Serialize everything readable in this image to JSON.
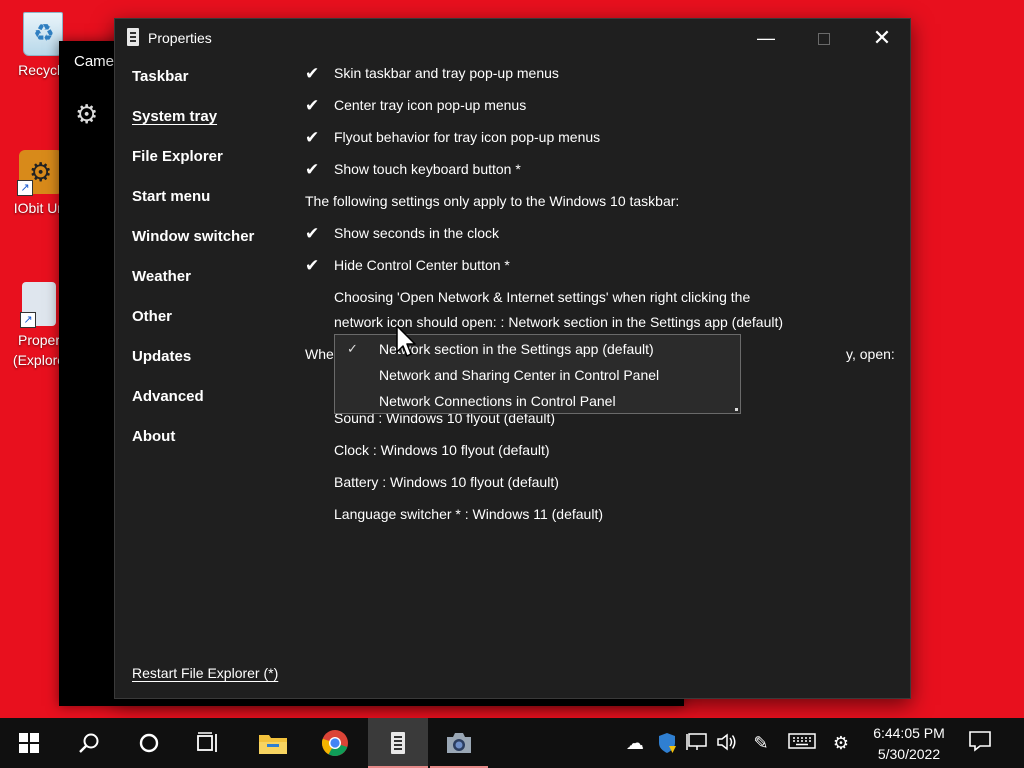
{
  "desktop": {
    "icons": [
      {
        "label": "Recycle"
      },
      {
        "label": "IObit Unl"
      },
      {
        "label": "Proper",
        "label2": "(Explore"
      }
    ]
  },
  "camera_window": {
    "title": "Camer"
  },
  "window": {
    "title": "Properties",
    "minimize_glyph": "—",
    "close_glyph": "✕"
  },
  "sidebar": {
    "items": [
      {
        "label": "Taskbar"
      },
      {
        "label": "System tray",
        "active": true
      },
      {
        "label": "File Explorer"
      },
      {
        "label": "Start menu"
      },
      {
        "label": "Window switcher"
      },
      {
        "label": "Weather"
      },
      {
        "label": "Other"
      },
      {
        "label": "Updates"
      },
      {
        "label": "Advanced"
      },
      {
        "label": "About"
      }
    ]
  },
  "content": {
    "check_items": [
      {
        "label": "Skin taskbar and tray pop-up menus",
        "checked": true
      },
      {
        "label": "Center tray icon pop-up menus",
        "checked": true
      },
      {
        "label": "Flyout behavior for tray icon pop-up menus",
        "checked": true
      },
      {
        "label": "Show touch keyboard button *",
        "checked": true
      }
    ],
    "win10_header": "The following settings only apply to the Windows 10 taskbar:",
    "win10_checks": [
      {
        "label": "Show seconds in the clock",
        "checked": true
      },
      {
        "label": "Hide Control Center button *",
        "checked": true
      }
    ],
    "network_line1": "Choosing 'Open Network & Internet settings' when right clicking the",
    "network_line2": "network icon should open: : Network section in the Settings app (default)",
    "partial_left": "Whe",
    "partial_right": "y, open:",
    "flyouts": [
      {
        "label": "Sound : Windows 10 flyout (default)"
      },
      {
        "label": "Clock : Windows 10 flyout (default)"
      },
      {
        "label": "Battery : Windows 10 flyout (default)"
      },
      {
        "label": "Language switcher * : Windows 11 (default)"
      }
    ]
  },
  "dropdown": {
    "options": [
      {
        "label": "Network section in the Settings app (default)",
        "selected": true
      },
      {
        "label": "Network and Sharing Center in Control Panel",
        "selected": false
      },
      {
        "label": "Network Connections in Control Panel",
        "selected": false
      }
    ]
  },
  "footer": {
    "restart_label": "Restart File Explorer (*)"
  },
  "taskbar": {
    "clock_time": "6:44:05 PM",
    "clock_date": "5/30/2022"
  },
  "colors": {
    "desktop_bg": "#e8101e",
    "window_bg": "#1f1f1f",
    "taskbar_bg": "#101010"
  }
}
